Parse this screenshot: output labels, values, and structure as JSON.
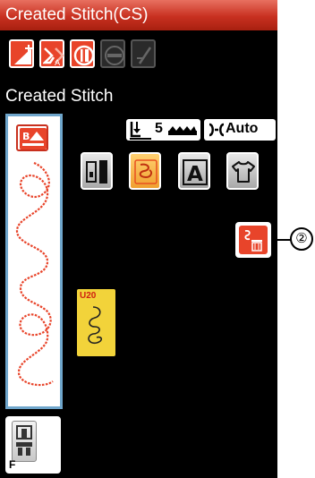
{
  "window": {
    "title": "Created Stitch(CS)"
  },
  "toolbar": {
    "buttons": [
      {
        "name": "elongation-icon",
        "state": "enabled"
      },
      {
        "name": "mirror-icon",
        "state": "enabled"
      },
      {
        "name": "split-stitch-icon",
        "state": "enabled"
      },
      {
        "name": "stitch-width-icon",
        "state": "disabled"
      },
      {
        "name": "stitch-length-icon",
        "state": "disabled"
      }
    ]
  },
  "main": {
    "heading": "Created Stitch",
    "status": {
      "presser_foot_pressure": "5",
      "thread_tension": "Auto"
    },
    "modes": [
      {
        "name": "utility-mode-icon",
        "active": false
      },
      {
        "name": "created-stitch-mode-icon",
        "active": true
      },
      {
        "name": "letter-mode-icon",
        "active": false
      },
      {
        "name": "shirt-mode-icon",
        "active": false
      }
    ],
    "stitch_tile": {
      "code": "U20"
    },
    "delete_button": {
      "callout": "②"
    }
  },
  "preview": {
    "stitch_color": "#e8442a",
    "border_color": "#6fa6cc"
  },
  "foot": {
    "label": "F"
  },
  "colors": {
    "accent": "#e8442a",
    "title_bar": "#c83020",
    "tile": "#f2d33a",
    "background": "#000000"
  }
}
